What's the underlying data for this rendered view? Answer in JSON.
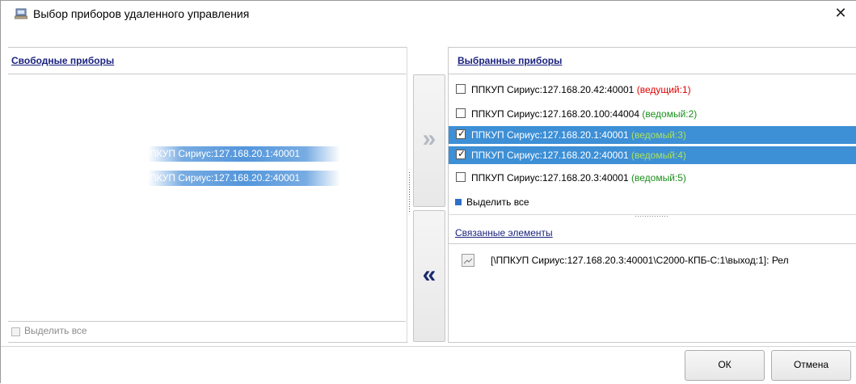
{
  "window": {
    "title": "Выбор приборов удаленного управления"
  },
  "left": {
    "header": "Свободные приборы",
    "drag_rows": [
      {
        "text": "ПКУП Сириус:127.168.20.1:40001"
      },
      {
        "text": "ПКУП Сириус:127.168.20.2:40001"
      }
    ],
    "select_all": "Выделить все"
  },
  "right": {
    "header": "Выбранные приборы",
    "devices": [
      {
        "name": "ППКУП Сириус:127.168.20.42:40001",
        "role": "(ведущий:1)",
        "role_color": "red",
        "checked": false,
        "selected": false
      },
      {
        "name": "ППКУП Сириус:127.168.20.100:44004",
        "role": "(ведомый:2)",
        "role_color": "green",
        "checked": false,
        "selected": false
      },
      {
        "name": "ППКУП Сириус:127.168.20.1:40001",
        "role": "(ведомый:3)",
        "role_color": "green",
        "checked": true,
        "selected": true
      },
      {
        "name": "ППКУП Сириус:127.168.20.2:40001",
        "role": "(ведомый:4)",
        "role_color": "green",
        "checked": true,
        "selected": true
      },
      {
        "name": "ППКУП Сириус:127.168.20.3:40001",
        "role": "(ведомый:5)",
        "role_color": "green",
        "checked": false,
        "selected": false
      }
    ],
    "select_all": "Выделить все",
    "linked_header": "Связанные элементы",
    "linked_item": "[\\ППКУП Сириус:127.168.20.3:40001\\С2000-КПБ-С:1\\выход:1]: Рел"
  },
  "buttons": {
    "add_glyph": "»",
    "remove_glyph": "«",
    "ok": "ОК",
    "cancel": "Отмена"
  },
  "colors": {
    "selection": "#3d8fd6",
    "role_master": "#e00000",
    "role_slave": "#1a8f1a",
    "link": "#1a237e"
  }
}
